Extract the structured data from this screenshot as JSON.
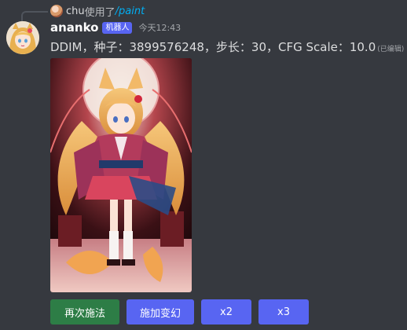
{
  "reply": {
    "user": "chu",
    "action_text": "使用了",
    "command": "/paint"
  },
  "message": {
    "username": "ananko",
    "badge": "机器人",
    "timestamp": "今天12:43",
    "content": "DDIM，种子：3899576248，步长：30，CFG Scale：10.0",
    "edited_label": "(已编辑)"
  },
  "attachment": {
    "description_icon": "generated-image"
  },
  "buttons": [
    {
      "label": "再次施法",
      "style": "success"
    },
    {
      "label": "施加变幻",
      "style": "primary"
    },
    {
      "label": "x2",
      "style": "primary"
    },
    {
      "label": "x3",
      "style": "primary"
    }
  ],
  "colors": {
    "background": "#36393f",
    "blurple": "#5865f2",
    "success": "#2d7d46",
    "link": "#00aff4"
  }
}
